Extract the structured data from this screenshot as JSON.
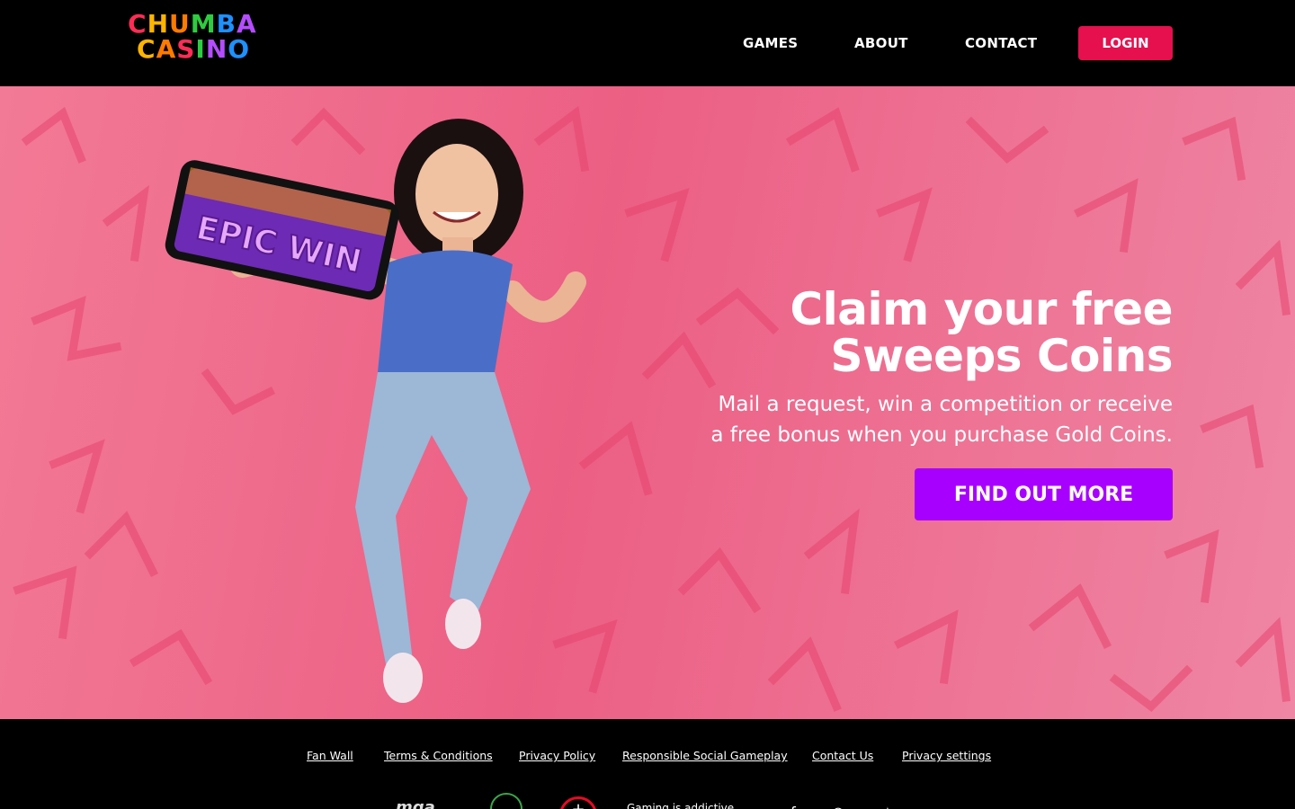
{
  "header": {
    "logo": {
      "line1": "CHUMBA",
      "line2": "CASINO"
    },
    "nav": [
      {
        "label": "GAMES"
      },
      {
        "label": "ABOUT"
      },
      {
        "label": "CONTACT"
      }
    ],
    "login_label": "LOGIN"
  },
  "hero": {
    "title_line1": "Claim your free",
    "title_line2": "Sweeps Coins",
    "subtitle_line1": "Mail a request, win a competition or receive",
    "subtitle_line2": "a free bonus when you purchase Gold Coins.",
    "cta_label": "FIND OUT MORE",
    "phone_screen_text": "EPIC WIN"
  },
  "footer": {
    "links": [
      {
        "label": "Fan Wall"
      },
      {
        "label": "Terms & Conditions"
      },
      {
        "label": "Privacy Policy"
      },
      {
        "label": "Responsible Social Gameplay"
      },
      {
        "label": "Contact Us"
      },
      {
        "label": "Privacy settings"
      }
    ],
    "mga_label": "mga",
    "gaming_notice": "Gaming is addictive",
    "social_icons": [
      "facebook-icon",
      "instagram-icon",
      "twitter-icon"
    ]
  },
  "colors": {
    "login_bg": "#e5104d",
    "cta_bg": "#a800ff",
    "hero_pink": "#ec5f84",
    "logo_colors": [
      "#ff2d55",
      "#ffb400",
      "#ff7a00",
      "#2ecc40",
      "#1e90ff",
      "#b44dff"
    ]
  }
}
